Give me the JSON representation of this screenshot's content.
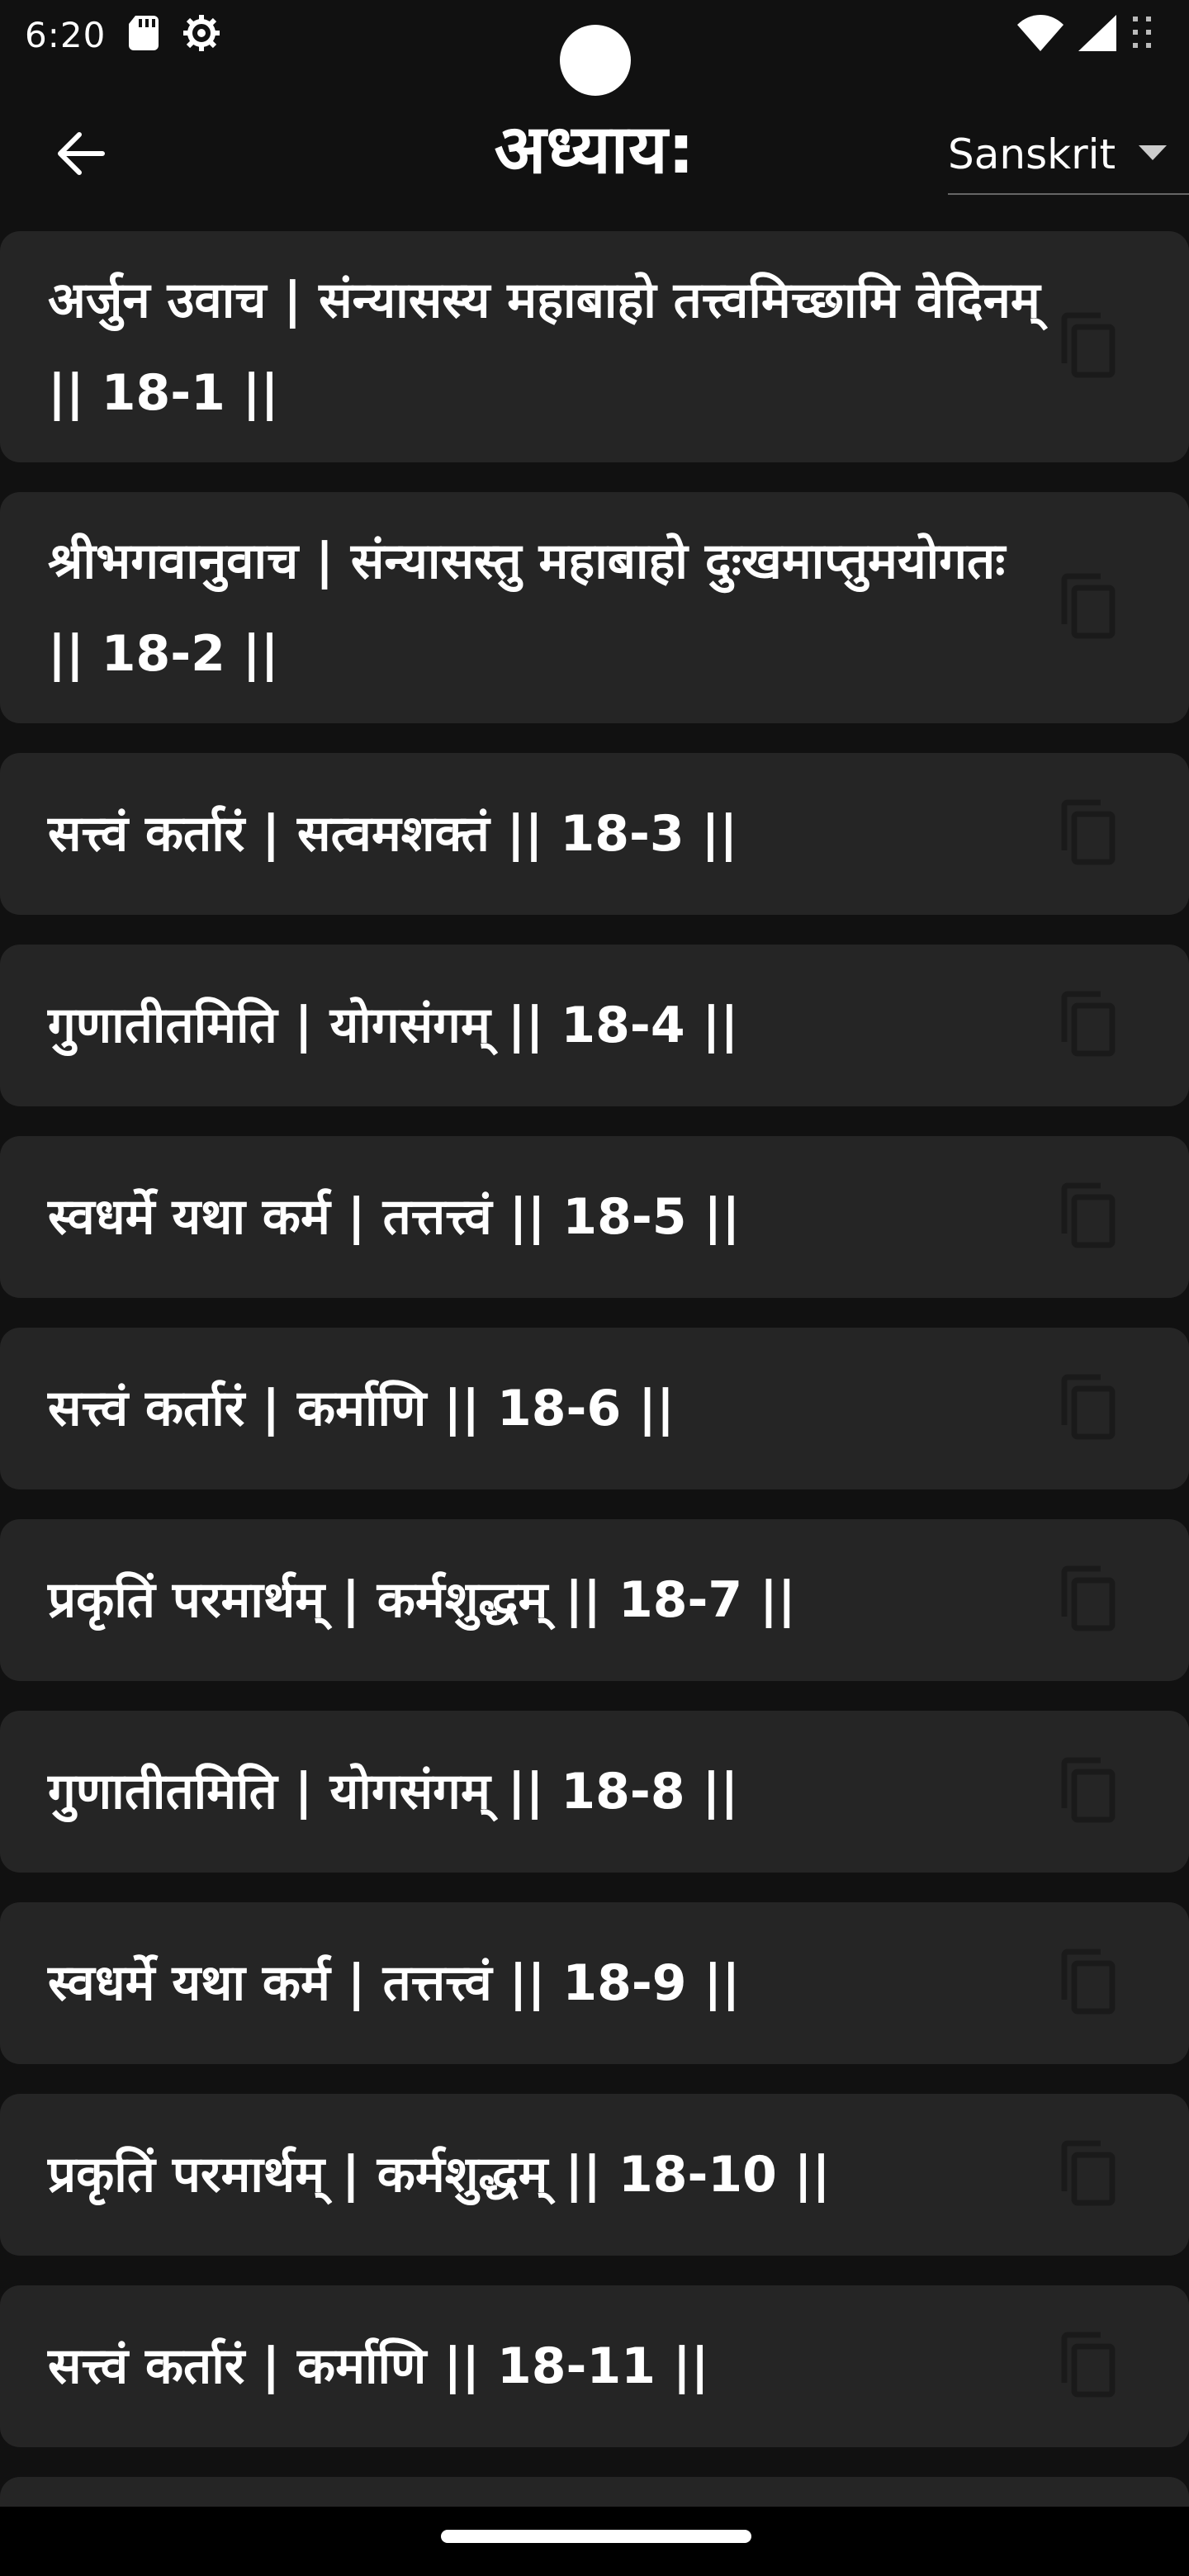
{
  "status": {
    "time": "6:20",
    "icons": [
      "sd-card-icon",
      "settings-icon",
      "wifi-icon",
      "cell-signal-icon",
      "battery-icon"
    ]
  },
  "header": {
    "title": "अध्याय:",
    "back_icon": "back-arrow-icon",
    "language_selected": "Sanskrit"
  },
  "verses": [
    {
      "text": "अर्जुन उवाच | संन्यासस्य महाबाहो तत्त्वमिच्छामि वेदिनम् || 18-1 ||"
    },
    {
      "text": "श्रीभगवानुवाच | संन्यासस्तु महाबाहो दुःखमाप्तुमयोगतः || 18-2 ||"
    },
    {
      "text": "सत्त्वं कर्तारं | सत्वमशक्तं || 18-3 ||"
    },
    {
      "text": "गुणातीतमिति | योगसंगम् || 18-4 ||"
    },
    {
      "text": "स्वधर्मे यथा कर्म | तत्तत्त्वं || 18-5 ||"
    },
    {
      "text": "सत्त्वं कर्तारं | कर्माणि || 18-6 ||"
    },
    {
      "text": "प्रकृतिं परमार्थम् | कर्मशुद्धम् || 18-7 ||"
    },
    {
      "text": "गुणातीतमिति | योगसंगम् || 18-8 ||"
    },
    {
      "text": "स्वधर्मे यथा कर्म | तत्तत्त्वं || 18-9 ||"
    },
    {
      "text": "प्रकृतिं परमार्थम् | कर्मशुद्धम् || 18-10 ||"
    },
    {
      "text": "सत्त्वं कर्तारं | कर्माणि || 18-11 ||"
    }
  ],
  "colors": {
    "background": "#111111",
    "card": "#252525",
    "text": "#ffffff",
    "icon": "#1a1a1a"
  }
}
